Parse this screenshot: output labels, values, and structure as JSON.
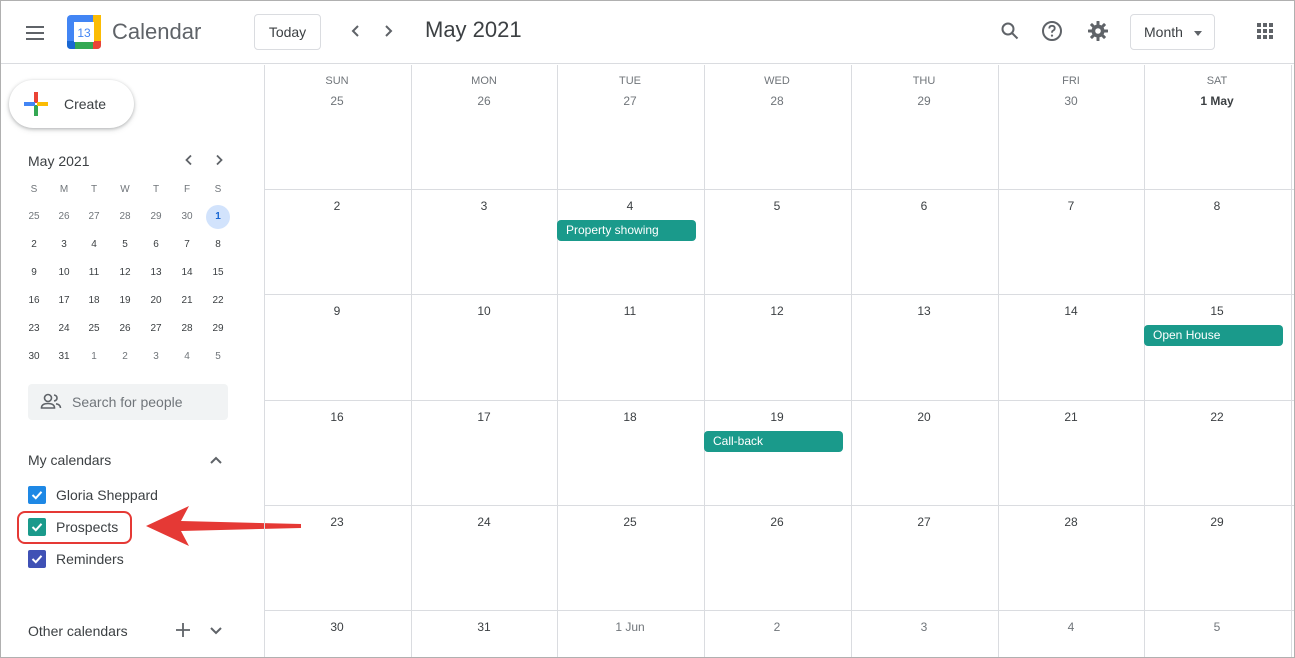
{
  "app": {
    "title": "Calendar",
    "logo_day": "13"
  },
  "header": {
    "today_label": "Today",
    "period_title": "May 2021",
    "view_label": "Month"
  },
  "sidebar": {
    "create_label": "Create",
    "mini_calendar": {
      "title": "May 2021",
      "dow": [
        "S",
        "M",
        "T",
        "W",
        "T",
        "F",
        "S"
      ],
      "weeks": [
        [
          "25",
          "26",
          "27",
          "28",
          "29",
          "30",
          "1"
        ],
        [
          "2",
          "3",
          "4",
          "5",
          "6",
          "7",
          "8"
        ],
        [
          "9",
          "10",
          "11",
          "12",
          "13",
          "14",
          "15"
        ],
        [
          "16",
          "17",
          "18",
          "19",
          "20",
          "21",
          "22"
        ],
        [
          "23",
          "24",
          "25",
          "26",
          "27",
          "28",
          "29"
        ],
        [
          "30",
          "31",
          "1",
          "2",
          "3",
          "4",
          "5"
        ]
      ]
    },
    "search_placeholder": "Search for people",
    "my_calendars_title": "My calendars",
    "my_calendars": [
      {
        "name": "Gloria Sheppard",
        "color": "#1e88e5",
        "checked": true
      },
      {
        "name": "Prospects",
        "color": "#1a9a8b",
        "checked": true
      },
      {
        "name": "Reminders",
        "color": "#3f51b5",
        "checked": true
      }
    ],
    "other_calendars_title": "Other calendars"
  },
  "month_grid": {
    "days_of_week": [
      "SUN",
      "MON",
      "TUE",
      "WED",
      "THU",
      "FRI",
      "SAT"
    ],
    "weeks": [
      [
        "25",
        "26",
        "27",
        "28",
        "29",
        "30",
        "1 May"
      ],
      [
        "2",
        "3",
        "4",
        "5",
        "6",
        "7",
        "8"
      ],
      [
        "9",
        "10",
        "11",
        "12",
        "13",
        "14",
        "15"
      ],
      [
        "16",
        "17",
        "18",
        "19",
        "20",
        "21",
        "22"
      ],
      [
        "23",
        "24",
        "25",
        "26",
        "27",
        "28",
        "29"
      ],
      [
        "30",
        "31",
        "1 Jun",
        "2",
        "3",
        "4",
        "5"
      ]
    ],
    "events": [
      {
        "title": "Property showing",
        "week": 1,
        "day": 2,
        "color": "#1a9a8b"
      },
      {
        "title": "Open House",
        "week": 2,
        "day": 6,
        "color": "#1a9a8b"
      },
      {
        "title": "Call-back",
        "week": 3,
        "day": 3,
        "color": "#1a9a8b"
      }
    ]
  },
  "colors": {
    "event": "#1a9a8b",
    "highlight": "#e53935",
    "selected_day_bg": "#d2e3fc"
  }
}
